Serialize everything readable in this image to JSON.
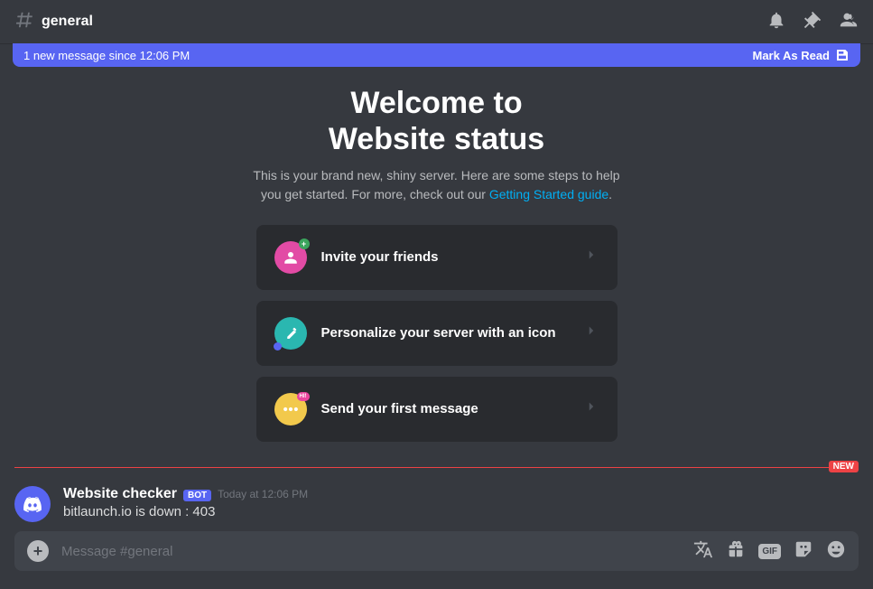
{
  "header": {
    "channel_name": "general"
  },
  "new_bar": {
    "text": "1 new message since 12:06 PM",
    "mark_read": "Mark As Read"
  },
  "welcome": {
    "title_line1": "Welcome to",
    "title_line2": "Website status",
    "desc_pre": "This is your brand new, shiny server. Here are some steps to help you get started. For more, check out our ",
    "guide_link": "Getting Started guide",
    "desc_post": "."
  },
  "cards": {
    "invite": "Invite your friends",
    "personalize": "Personalize your server with an icon",
    "first_msg": "Send your first message"
  },
  "divider": {
    "new_label": "NEW"
  },
  "message": {
    "author": "Website checker",
    "bot_tag": "BOT",
    "timestamp": "Today at 12:06 PM",
    "content": "bitlaunch.io is down : 403"
  },
  "input": {
    "placeholder": "Message #general",
    "gif_label": "GIF"
  }
}
